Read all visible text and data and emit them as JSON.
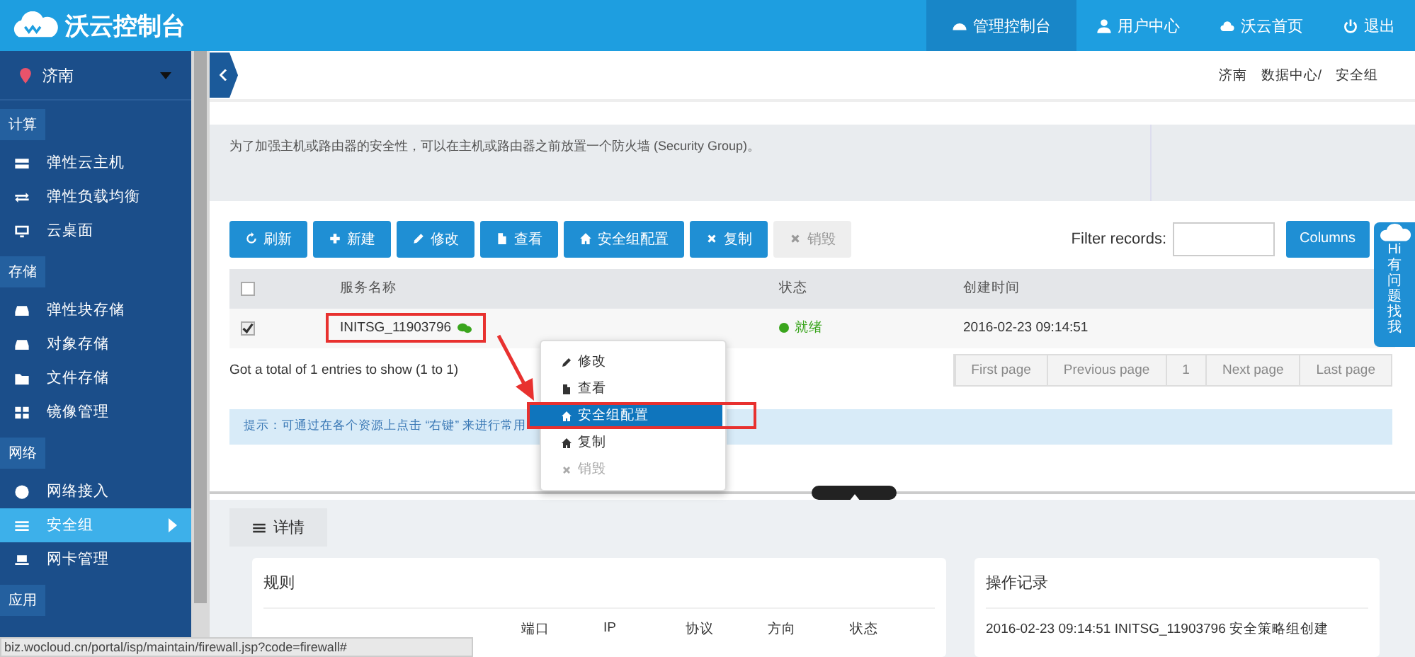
{
  "header": {
    "logo": "沃云控制台",
    "nav": [
      {
        "label": "管理控制台",
        "selected": true
      },
      {
        "label": "用户中心",
        "selected": false
      },
      {
        "label": "沃云首页",
        "selected": false
      },
      {
        "label": "退出",
        "selected": false
      }
    ]
  },
  "sidebar": {
    "region": "济南",
    "sections": [
      {
        "title": "计算",
        "items": [
          {
            "label": "弹性云主机",
            "selected": false
          },
          {
            "label": "弹性负载均衡",
            "selected": false
          },
          {
            "label": "云桌面",
            "selected": false
          }
        ]
      },
      {
        "title": "存储",
        "items": [
          {
            "label": "弹性块存储",
            "selected": false
          },
          {
            "label": "对象存储",
            "selected": false
          },
          {
            "label": "文件存储",
            "selected": false
          },
          {
            "label": "镜像管理",
            "selected": false
          }
        ]
      },
      {
        "title": "网络",
        "items": [
          {
            "label": "网络接入",
            "selected": false
          },
          {
            "label": "安全组",
            "selected": true
          },
          {
            "label": "网卡管理",
            "selected": false
          }
        ]
      },
      {
        "title": "应用"
      }
    ]
  },
  "breadcrumb": [
    "济南",
    "数据中心/",
    "安全组"
  ],
  "description": "为了加强主机或路由器的安全性，可以在主机或路由器之前放置一个防火墙 (Security Group)。",
  "toolbar": [
    {
      "label": "刷新",
      "disabled": false
    },
    {
      "label": "新建",
      "disabled": false
    },
    {
      "label": "修改",
      "disabled": false
    },
    {
      "label": "查看",
      "disabled": false
    },
    {
      "label": "安全组配置",
      "disabled": false
    },
    {
      "label": "复制",
      "disabled": false
    },
    {
      "label": "销毁",
      "disabled": true
    }
  ],
  "filter": {
    "label": "Filter records:"
  },
  "columns_button": "Columns",
  "table": {
    "header_checked": false,
    "columns": [
      "服务名称",
      "状态",
      "创建时间"
    ],
    "rows": [
      {
        "checked": true,
        "name": "INITSG_11903796",
        "status": "就绪",
        "color": "#3aa51d",
        "created": "2016-02-23 09:14:51"
      }
    ]
  },
  "summary": "Got a total of 1 entries to show (1 to 1)",
  "pagination": [
    "First page",
    "Previous page",
    "1",
    "Next page",
    "Last page"
  ],
  "hint": "提示：可通过在各个资源上点击 “右键” 来进行常用",
  "context_menu": [
    {
      "label": "修改",
      "selected": false,
      "disabled": false
    },
    {
      "label": "查看",
      "selected": false,
      "disabled": false
    },
    {
      "label": "安全组配置",
      "selected": true,
      "disabled": false
    },
    {
      "label": "复制",
      "selected": false,
      "disabled": false
    },
    {
      "label": "销毁",
      "selected": false,
      "disabled": true
    }
  ],
  "details": {
    "tab": "详情",
    "rules": {
      "title": "规则",
      "columns": [
        "端口",
        "IP",
        "协议",
        "方向",
        "状态"
      ]
    },
    "log": {
      "title": "操作记录",
      "entries": [
        "2016-02-23 09:14:51 INITSG_11903796 安全策略组创建"
      ]
    }
  },
  "help_widget": {
    "greeting": "Hi",
    "text": "有问题找我"
  },
  "status_url": "biz.wocloud.cn/portal/isp/maintain/firewall.jsp?code=firewall#"
}
